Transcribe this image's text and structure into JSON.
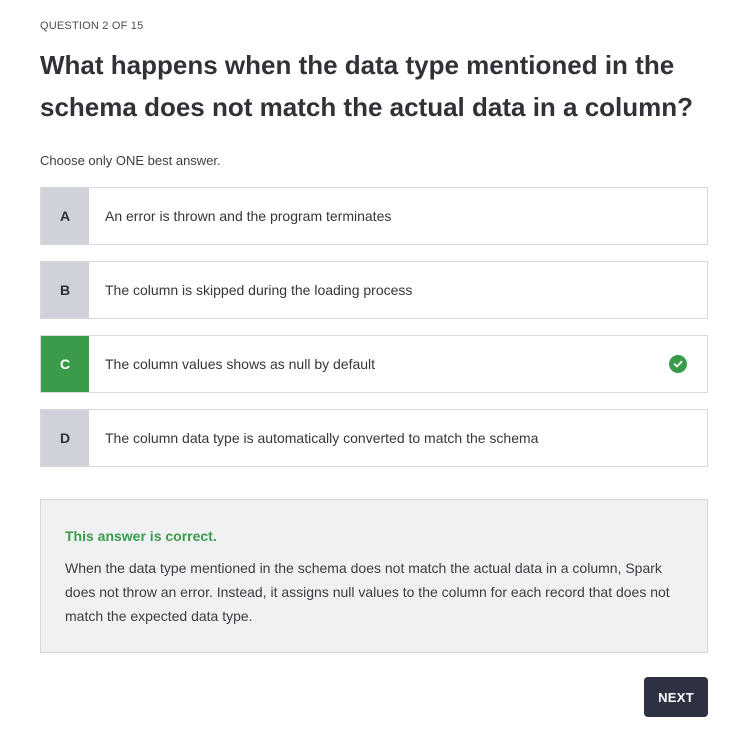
{
  "quiz": {
    "counter": "QUESTION 2 OF 15",
    "question": "What happens when the data type mentioned in the schema does not match the actual data in a column?",
    "instruction": "Choose only ONE best answer."
  },
  "options": [
    {
      "letter": "A",
      "text": "An error is thrown and the program terminates",
      "state": "default"
    },
    {
      "letter": "B",
      "text": "The column is skipped during the loading process",
      "state": "default"
    },
    {
      "letter": "C",
      "text": "The column values shows as null by default",
      "state": "correct",
      "icon": "check-circle-icon"
    },
    {
      "letter": "D",
      "text": "The column data type is automatically converted to match the schema",
      "state": "default"
    }
  ],
  "feedback": {
    "verdict": "This answer is correct.",
    "explanation": "When the data type mentioned in the schema does not match the actual data in a column, Spark does not throw an error. Instead, it assigns null values to the column for each record that does not match the expected data type."
  },
  "actions": {
    "next_label": "NEXT"
  },
  "colors": {
    "correct": "#3a9b4a",
    "letter_bg": "#cfd2d8",
    "button_bg": "#2d3142",
    "feedback_bg": "#eff1f3"
  }
}
